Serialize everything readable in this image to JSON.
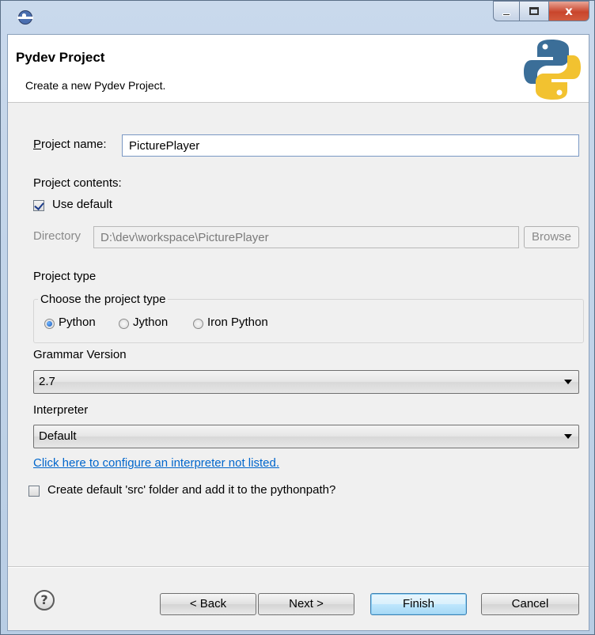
{
  "window": {
    "title": "",
    "icon": "eclipse-icon",
    "controls": {
      "minimize": "",
      "maximize": "",
      "close": "x"
    }
  },
  "header": {
    "title": "Pydev Project",
    "subtitle": "Create a new Pydev Project.",
    "logo": "python-logo"
  },
  "project_name": {
    "label": "Project name:",
    "value": "PicturePlayer"
  },
  "project_contents": {
    "label": "Project contents:",
    "use_default": {
      "label": "Use default",
      "checked": true
    },
    "directory": {
      "label": "Directory",
      "value": "D:\\dev\\workspace\\PicturePlayer",
      "enabled": false
    },
    "browse_label": "Browse"
  },
  "project_type": {
    "label": "Project type",
    "group_label": "Choose the project type",
    "options": [
      {
        "label": "Python",
        "checked": true
      },
      {
        "label": "Jython",
        "checked": false
      },
      {
        "label": "Iron Python",
        "checked": false
      }
    ]
  },
  "grammar": {
    "label": "Grammar Version",
    "selected": "2.7"
  },
  "interpreter": {
    "label": "Interpreter",
    "selected": "Default",
    "configure_link": "Click here to configure an interpreter not listed."
  },
  "create_src": {
    "label": "Create default 'src' folder and add it to the pythonpath?",
    "checked": false
  },
  "footer": {
    "help_icon": "?",
    "back_label": "< Back",
    "next_label": "Next >",
    "finish_label": "Finish",
    "cancel_label": "Cancel"
  },
  "colors": {
    "link": "#0066cc",
    "close_button": "#c9452c",
    "default_button": "#3c7fb1",
    "dialog_background": "#f0f0f0"
  }
}
